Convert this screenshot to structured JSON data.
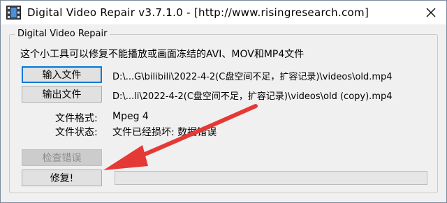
{
  "window": {
    "title": "Digital Video Repair v3.7.1.0 - [http://www.risingresearch.com]"
  },
  "group": {
    "title": "Digital Video Repair",
    "description": "这个小工具可以修复不能播放或画面冻结的AVI、MOV和MP4文件"
  },
  "files": {
    "input_button": "输入文件",
    "input_path": "D:\\...G\\bilibili\\2022-4-2(C盘空间不足，扩容记录)\\videos\\old.mp4",
    "output_button": "输出文件",
    "output_path": "D:\\...li\\2022-4-2(C盘空间不足，扩容记录)\\videos\\old (copy).mp4"
  },
  "info": {
    "format_label": "文件格式:",
    "format_value": "Mpeg 4",
    "status_label": "文件状态:",
    "status_value": "文件已经损坏: 数据错误"
  },
  "actions": {
    "check_button": "检查错误",
    "repair_button": "修复!"
  },
  "progress": {
    "value": 0
  },
  "colors": {
    "arrow": "#e53935",
    "focus": "#0078d7"
  },
  "icons": {
    "app": "video-film-icon",
    "close": "close-icon",
    "annotation": "red-arrow"
  }
}
